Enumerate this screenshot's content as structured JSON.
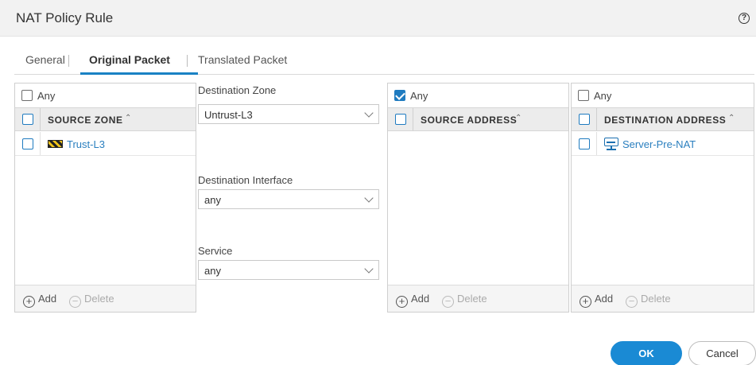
{
  "dialog": {
    "title": "NAT Policy Rule"
  },
  "tabs": [
    {
      "label": "General"
    },
    {
      "label": "Original Packet"
    },
    {
      "label": "Translated Packet"
    }
  ],
  "source_zone_panel": {
    "any_label": "Any",
    "any_checked": false,
    "header": "SOURCE ZONE",
    "items": [
      "Trust-L3"
    ],
    "add_label": "Add",
    "delete_label": "Delete"
  },
  "middle": {
    "destination_zone": {
      "label": "Destination Zone",
      "value": "Untrust-L3"
    },
    "destination_interface": {
      "label": "Destination Interface",
      "value": "any"
    },
    "service": {
      "label": "Service",
      "value": "any"
    }
  },
  "source_address_panel": {
    "any_label": "Any",
    "any_checked": true,
    "header": "SOURCE ADDRESS",
    "items": [],
    "add_label": "Add",
    "delete_label": "Delete"
  },
  "destination_address_panel": {
    "any_label": "Any",
    "any_checked": false,
    "header": "DESTINATION ADDRESS",
    "items": [
      "Server-Pre-NAT"
    ],
    "add_label": "Add",
    "delete_label": "Delete"
  },
  "buttons": {
    "ok": "OK",
    "cancel": "Cancel"
  },
  "colors": {
    "accent": "#1a8ad4",
    "link": "#2a7fbf"
  }
}
